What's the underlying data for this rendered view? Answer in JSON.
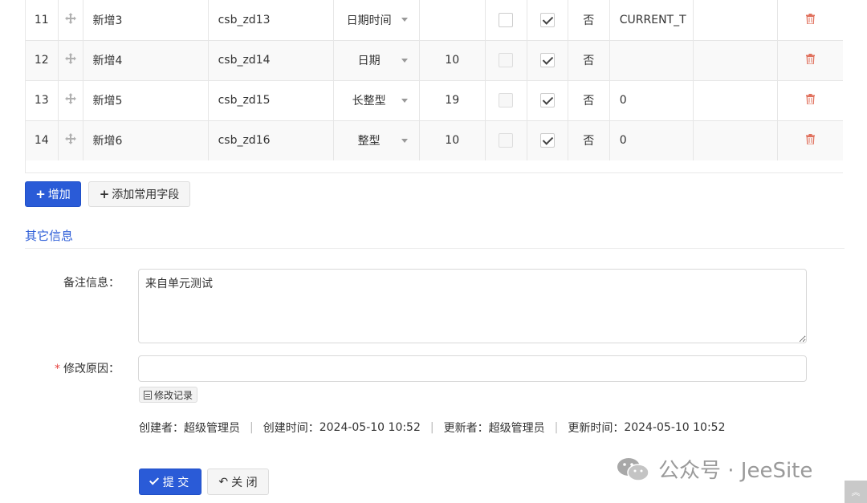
{
  "grid": {
    "rows": [
      {
        "no": "11",
        "name": "新增3",
        "code": "csb_zd13",
        "type": "日期时间",
        "length": "",
        "chk1": false,
        "chk2": true,
        "nullable": "否",
        "default": "CURRENT_T"
      },
      {
        "no": "12",
        "name": "新增4",
        "code": "csb_zd14",
        "type": "日期",
        "length": "10",
        "chk1": false,
        "chk2": true,
        "nullable": "否",
        "default": ""
      },
      {
        "no": "13",
        "name": "新增5",
        "code": "csb_zd15",
        "type": "长整型",
        "length": "19",
        "chk1": false,
        "chk2": true,
        "nullable": "否",
        "default": "0"
      },
      {
        "no": "14",
        "name": "新增6",
        "code": "csb_zd16",
        "type": "整型",
        "length": "10",
        "chk1": false,
        "chk2": true,
        "nullable": "否",
        "default": "0"
      }
    ]
  },
  "actions": {
    "add_label": "增加",
    "add_common_label": "添加常用字段"
  },
  "section": {
    "title": "其它信息"
  },
  "form": {
    "remarks_label": "备注信息：",
    "remarks_value": "来自单元测试",
    "reason_label": "修改原因：",
    "reason_value": "",
    "history_label": "修改记录"
  },
  "meta": {
    "creator_label": "创建者：",
    "creator": "超级管理员",
    "create_time_label": "创建时间：",
    "create_time": "2024-05-10 10:52",
    "updater_label": "更新者：",
    "updater": "超级管理员",
    "update_time_label": "更新时间：",
    "update_time": "2024-05-10 10:52",
    "separator": "|"
  },
  "footer": {
    "submit_label": "提 交",
    "close_label": "关 闭"
  },
  "watermark": {
    "text": "公众号 · JeeSite"
  },
  "colors": {
    "primary": "#2a5bd7",
    "trash": "#e0705c",
    "required": "#e64340"
  }
}
